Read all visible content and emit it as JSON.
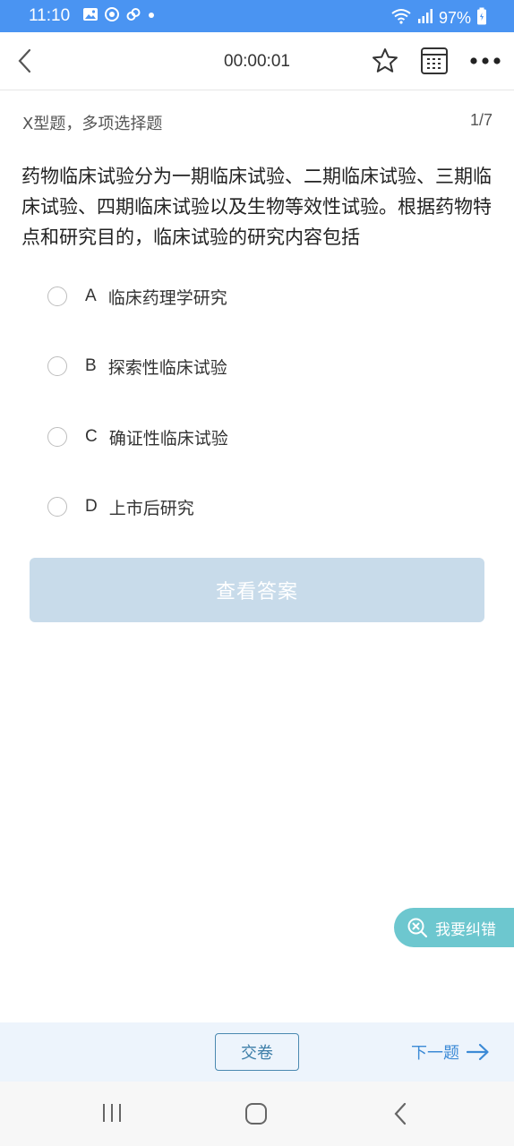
{
  "status_bar": {
    "time": "11:10",
    "battery": "97%"
  },
  "header": {
    "timer": "00:00:01"
  },
  "question": {
    "type_label": "X型题，多项选择题",
    "progress": "1/7",
    "stem": "药物临床试验分为一期临床试验、二期临床试验、三期临床试验、四期临床试验以及生物等效性试验。根据药物特点和研究目的，临床试验的研究内容包括",
    "options": [
      {
        "letter": "A",
        "text": "临床药理学研究"
      },
      {
        "letter": "B",
        "text": "探索性临床试验"
      },
      {
        "letter": "C",
        "text": "确证性临床试验"
      },
      {
        "letter": "D",
        "text": "上市后研究"
      }
    ]
  },
  "actions": {
    "view_answer": "查看答案",
    "report_error": "我要纠错",
    "submit": "交卷",
    "next": "下一题"
  },
  "colors": {
    "status_bar": "#4a94f2",
    "answer_button": "#c8dbea",
    "report_button": "#6dc7cf",
    "bottom_bar": "#edf4fc",
    "next_link": "#3c8ad6"
  }
}
